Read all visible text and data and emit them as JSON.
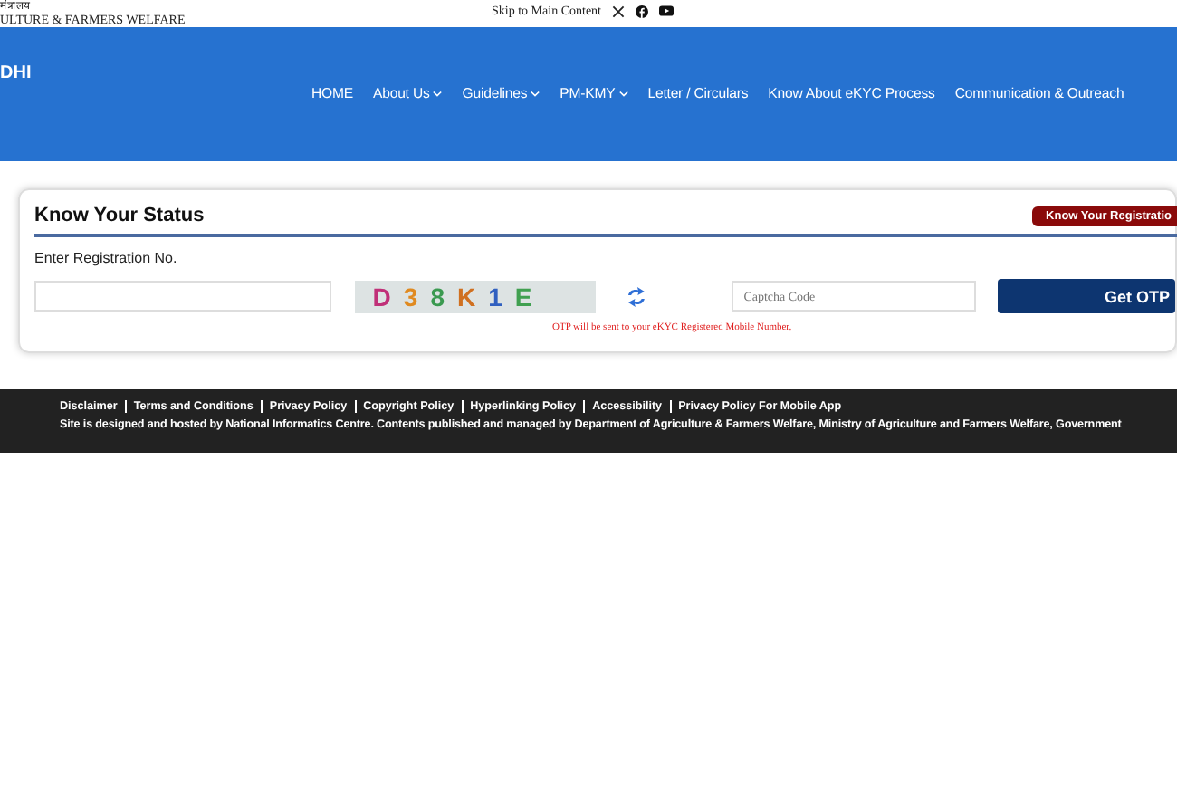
{
  "top_bar": {
    "ministry_hindi": "मंत्रालय",
    "ministry": "ULTURE & FARMERS WELFARE",
    "skip_link": "Skip to Main Content"
  },
  "header": {
    "brand": "DHI",
    "nav": [
      {
        "label": "HOME",
        "dropdown": false
      },
      {
        "label": "About Us",
        "dropdown": true
      },
      {
        "label": "Guidelines",
        "dropdown": true
      },
      {
        "label": "PM-KMY",
        "dropdown": true
      },
      {
        "label": "Letter / Circulars",
        "dropdown": false
      },
      {
        "label": "Know About eKYC Process",
        "dropdown": false
      },
      {
        "label": "Communication & Outreach",
        "dropdown": false
      }
    ]
  },
  "status_card": {
    "title": "Know Your Status",
    "registration_button": "Know Your Registratio",
    "field_label": "Enter Registration No.",
    "captcha": [
      {
        "char": "D",
        "color": "#c03078"
      },
      {
        "char": "3",
        "color": "#e08a20"
      },
      {
        "char": "8",
        "color": "#3a9a50"
      },
      {
        "char": "K",
        "color": "#d07020"
      },
      {
        "char": "1",
        "color": "#3060c0"
      },
      {
        "char": "E",
        "color": "#40a050"
      }
    ],
    "captcha_placeholder": "Captcha Code",
    "otp_button": "Get OTP",
    "otp_note": "OTP will be sent to your eKYC Registered Mobile Number."
  },
  "footer": {
    "links": [
      "Disclaimer",
      "Terms and Conditions",
      "Privacy Policy",
      "Copyright Policy",
      "Hyperlinking Policy",
      "Accessibility",
      "Privacy Policy For Mobile App"
    ],
    "credit": "Site is designed and hosted by National Informatics Centre. Contents published and managed by Department of Agriculture & Farmers Welfare, Ministry of Agriculture and Farmers Welfare, Government"
  }
}
